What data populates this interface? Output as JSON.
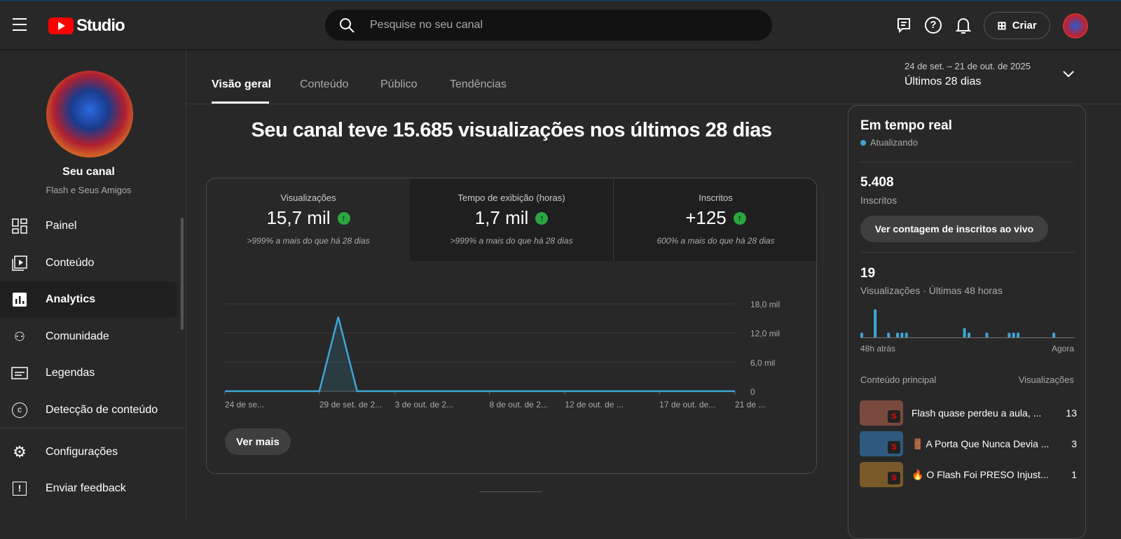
{
  "header": {
    "logo_text": "Studio",
    "search_placeholder": "Pesquise no seu canal",
    "create_label": "Criar"
  },
  "sidebar": {
    "channel_title": "Seu canal",
    "channel_name": "Flash e Seus Amigos",
    "items": [
      {
        "label": "Painel",
        "icon": "dashboard-icon"
      },
      {
        "label": "Conteúdo",
        "icon": "content-icon"
      },
      {
        "label": "Analytics",
        "icon": "analytics-icon"
      },
      {
        "label": "Comunidade",
        "icon": "community-icon"
      },
      {
        "label": "Legendas",
        "icon": "subtitles-icon"
      },
      {
        "label": "Detecção de conteúdo",
        "icon": "copyright-icon"
      }
    ],
    "bottom": [
      {
        "label": "Configurações",
        "icon": "gear-icon"
      },
      {
        "label": "Enviar feedback",
        "icon": "feedback-icon"
      }
    ]
  },
  "tabs": [
    "Visão geral",
    "Conteúdo",
    "Público",
    "Tendências"
  ],
  "date_range": {
    "range": "24 de set. – 21 de out. de 2025",
    "label": "Últimos 28 dias"
  },
  "headline": "Seu canal teve 15.685 visualizações nos últimos 28 dias",
  "metrics": [
    {
      "label": "Visualizações",
      "value": "15,7 mil",
      "compare": ">999% a mais do que há 28 dias"
    },
    {
      "label": "Tempo de exibição (horas)",
      "value": "1,7 mil",
      "compare": ">999% a mais do que há 28 dias"
    },
    {
      "label": "Inscritos",
      "value": "+125",
      "compare": "600% a mais do que há 28 dias"
    }
  ],
  "see_more": "Ver mais",
  "chart_data": {
    "type": "line",
    "title": "Visualizações",
    "ylim": [
      0,
      18000
    ],
    "yticks": [
      "0",
      "6,0 mil",
      "12,0 mil",
      "18,0 mil"
    ],
    "ytick_values": [
      0,
      6000,
      12000,
      18000
    ],
    "xtick_labels": [
      "24 de se...",
      "29 de set. de 2...",
      "3 de out. de 2...",
      "8 de out. de 2...",
      "12 de out. de ...",
      "17 de out. de...",
      "21 de ..."
    ],
    "xtick_index": [
      0,
      5,
      9,
      14,
      18,
      23,
      27
    ],
    "values": [
      12,
      10,
      14,
      11,
      13,
      15,
      15300,
      20,
      14,
      12,
      13,
      11,
      15,
      14,
      12,
      13,
      14,
      12,
      11,
      13,
      14,
      12,
      13,
      15,
      14,
      12,
      13,
      14
    ],
    "color": "#3ea6d6"
  },
  "realtime": {
    "title": "Em tempo real",
    "status": "Atualizando",
    "subs_value": "5.408",
    "subs_label": "Inscritos",
    "live_button": "Ver contagem de inscritos ao vivo",
    "views_value": "19",
    "views_label": "Visualizações · Últimas 48 horas",
    "spark_start": "48h atrás",
    "spark_end": "Agora",
    "hourly": [
      1,
      0,
      0,
      6,
      0,
      0,
      1,
      0,
      1,
      1,
      1,
      0,
      0,
      0,
      0,
      0,
      0,
      0,
      0,
      0,
      0,
      0,
      0,
      2,
      1,
      0,
      0,
      0,
      1,
      0,
      0,
      0,
      0,
      1,
      1,
      1,
      0,
      0,
      0,
      0,
      0,
      0,
      0,
      1,
      0,
      0,
      0,
      0
    ],
    "top_header": "Conteúdo principal",
    "top_views_header": "Visualizações",
    "top": [
      {
        "title": "Flash quase perdeu a aula, ...",
        "views": "13",
        "color": "#7a4a3e"
      },
      {
        "title": "🚪 A Porta Que Nunca Devia ...",
        "views": "3",
        "color": "#2e5a80"
      },
      {
        "title": "🔥 O Flash Foi PRESO Injust...",
        "views": "1",
        "color": "#7a5a2a"
      }
    ]
  }
}
